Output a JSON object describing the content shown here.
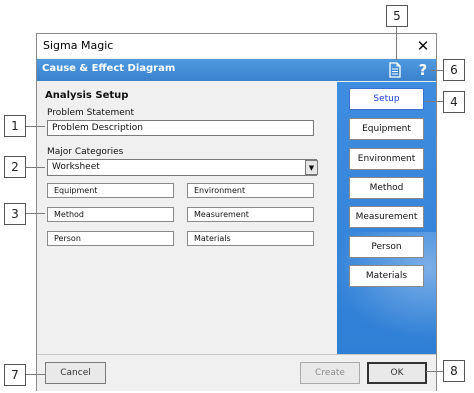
{
  "window": {
    "title": "Sigma Magic",
    "close_glyph": "✕"
  },
  "banner": {
    "title": "Cause & Effect Diagram",
    "help_glyph": "?"
  },
  "analysis": {
    "heading": "Analysis Setup",
    "problem_label": "Problem Statement",
    "problem_value": "Problem Description",
    "categories_label": "Major Categories",
    "categories_selected": "Worksheet",
    "categories": [
      "Equipment",
      "Environment",
      "Method",
      "Measurement",
      "Person",
      "Materials"
    ]
  },
  "sidebar": {
    "buttons": [
      "Setup",
      "Equipment",
      "Environment",
      "Method",
      "Measurement",
      "Person",
      "Materials"
    ],
    "active": "Setup"
  },
  "footer": {
    "cancel": "Cancel",
    "create": "Create",
    "ok": "OK"
  },
  "callouts": [
    "1",
    "2",
    "3",
    "4",
    "5",
    "6",
    "7",
    "8"
  ],
  "colors": {
    "banner": "#3a82cc",
    "sidebar": "#2f7fd6",
    "active_text": "#1a3fd6"
  },
  "icons": {
    "doc": "document-icon",
    "help": "help-icon",
    "dropdown": "chevron-down-icon",
    "close": "close-icon"
  }
}
